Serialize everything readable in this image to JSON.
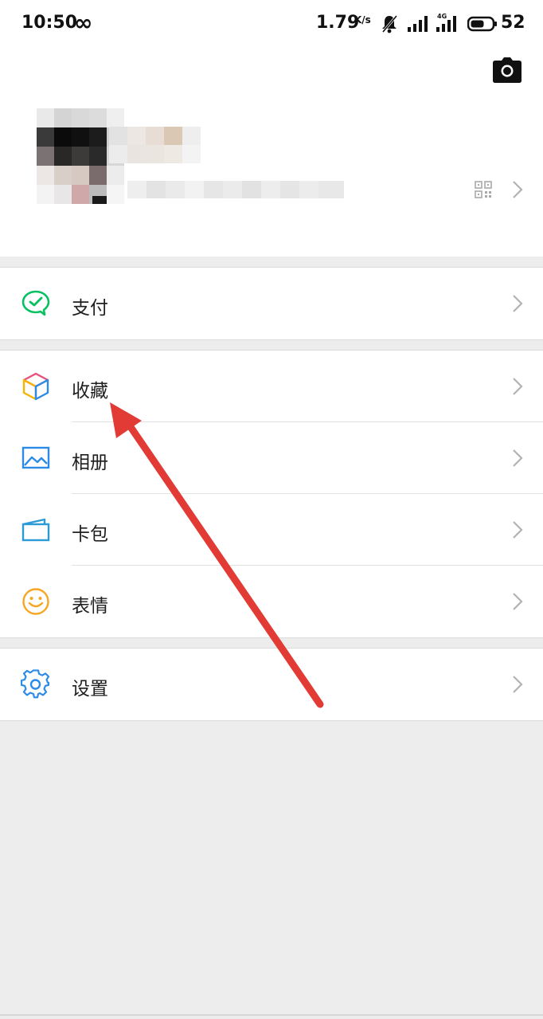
{
  "status_bar": {
    "time": "10:50",
    "infinity": "∞",
    "speed": "1.79",
    "speed_unit": "K/s",
    "network": "4G",
    "battery": "52",
    "icons": [
      "infinity-icon",
      "mute-bell-icon",
      "signal-icon",
      "signal-4g-icon",
      "battery-icon"
    ]
  },
  "header": {
    "camera_icon": "camera-icon",
    "qr_icon": "qr-code-icon"
  },
  "menu_groups": [
    [
      {
        "label": "支付",
        "icon": "wechat-pay-icon",
        "color": "#07c160"
      }
    ],
    [
      {
        "label": "收藏",
        "icon": "favorites-cube-icon",
        "color": "#f4b400"
      },
      {
        "label": "相册",
        "icon": "album-icon",
        "color": "#2b8be6"
      },
      {
        "label": "卡包",
        "icon": "card-wallet-icon",
        "color": "#2b9bd6"
      },
      {
        "label": "表情",
        "icon": "emoji-icon",
        "color": "#f6a623"
      }
    ],
    [
      {
        "label": "设置",
        "icon": "settings-gear-icon",
        "color": "#2b8be6"
      }
    ]
  ],
  "annotation": {
    "arrow_color": "#e23a34"
  }
}
